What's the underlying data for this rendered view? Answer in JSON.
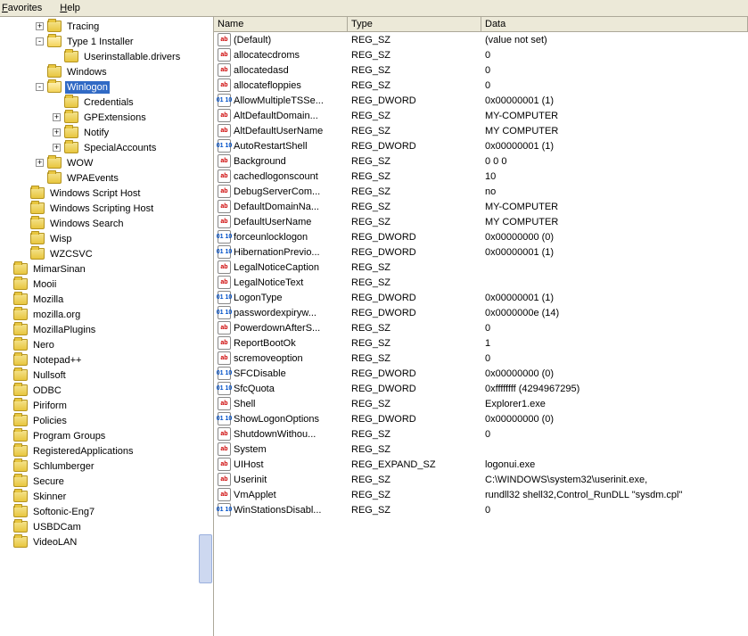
{
  "menu": {
    "favorites": "Favorites",
    "help": "Help"
  },
  "columns": {
    "name": "Name",
    "type": "Type",
    "data": "Data"
  },
  "tree": [
    {
      "indent": 1,
      "expander": "+",
      "label": "Tracing"
    },
    {
      "indent": 1,
      "expander": "-",
      "label": "Type 1 Installer",
      "open": true
    },
    {
      "indent": 2,
      "expander": "",
      "label": "Userinstallable.drivers"
    },
    {
      "indent": 1,
      "expander": "",
      "label": "Windows"
    },
    {
      "indent": 1,
      "expander": "-",
      "label": "Winlogon",
      "open": true,
      "selected": true
    },
    {
      "indent": 2,
      "expander": "",
      "label": "Credentials"
    },
    {
      "indent": 2,
      "expander": "+",
      "label": "GPExtensions"
    },
    {
      "indent": 2,
      "expander": "+",
      "label": "Notify"
    },
    {
      "indent": 2,
      "expander": "+",
      "label": "SpecialAccounts"
    },
    {
      "indent": 1,
      "expander": "+",
      "label": "WOW"
    },
    {
      "indent": 1,
      "expander": "",
      "label": "WPAEvents"
    },
    {
      "indent": 0,
      "expander": "",
      "label": "Windows Script Host"
    },
    {
      "indent": 0,
      "expander": "",
      "label": "Windows Scripting Host"
    },
    {
      "indent": 0,
      "expander": "",
      "label": "Windows Search"
    },
    {
      "indent": 0,
      "expander": "",
      "label": "Wisp"
    },
    {
      "indent": 0,
      "expander": "",
      "label": "WZCSVC"
    },
    {
      "indent": -1,
      "expander": "",
      "label": "MimarSinan"
    },
    {
      "indent": -1,
      "expander": "",
      "label": "Mooii"
    },
    {
      "indent": -1,
      "expander": "",
      "label": "Mozilla"
    },
    {
      "indent": -1,
      "expander": "",
      "label": "mozilla.org"
    },
    {
      "indent": -1,
      "expander": "",
      "label": "MozillaPlugins"
    },
    {
      "indent": -1,
      "expander": "",
      "label": "Nero"
    },
    {
      "indent": -1,
      "expander": "",
      "label": "Notepad++"
    },
    {
      "indent": -1,
      "expander": "",
      "label": "Nullsoft"
    },
    {
      "indent": -1,
      "expander": "",
      "label": "ODBC"
    },
    {
      "indent": -1,
      "expander": "",
      "label": "Piriform"
    },
    {
      "indent": -1,
      "expander": "",
      "label": "Policies"
    },
    {
      "indent": -1,
      "expander": "",
      "label": "Program Groups"
    },
    {
      "indent": -1,
      "expander": "",
      "label": "RegisteredApplications"
    },
    {
      "indent": -1,
      "expander": "",
      "label": "Schlumberger"
    },
    {
      "indent": -1,
      "expander": "",
      "label": "Secure"
    },
    {
      "indent": -1,
      "expander": "",
      "label": "Skinner"
    },
    {
      "indent": -1,
      "expander": "",
      "label": "Softonic-Eng7"
    },
    {
      "indent": -1,
      "expander": "",
      "label": "USBDCam"
    },
    {
      "indent": -1,
      "expander": "",
      "label": "VideoLAN"
    }
  ],
  "values": [
    {
      "icon": "sz",
      "name": "(Default)",
      "type": "REG_SZ",
      "data": "(value not set)"
    },
    {
      "icon": "sz",
      "name": "allocatecdroms",
      "type": "REG_SZ",
      "data": "0"
    },
    {
      "icon": "sz",
      "name": "allocatedasd",
      "type": "REG_SZ",
      "data": "0"
    },
    {
      "icon": "sz",
      "name": "allocatefloppies",
      "type": "REG_SZ",
      "data": "0"
    },
    {
      "icon": "dw",
      "name": "AllowMultipleTSSe...",
      "type": "REG_DWORD",
      "data": "0x00000001 (1)"
    },
    {
      "icon": "sz",
      "name": "AltDefaultDomain...",
      "type": "REG_SZ",
      "data": "MY-COMPUTER"
    },
    {
      "icon": "sz",
      "name": "AltDefaultUserName",
      "type": "REG_SZ",
      "data": "MY COMPUTER"
    },
    {
      "icon": "dw",
      "name": "AutoRestartShell",
      "type": "REG_DWORD",
      "data": "0x00000001 (1)"
    },
    {
      "icon": "sz",
      "name": "Background",
      "type": "REG_SZ",
      "data": "0 0 0"
    },
    {
      "icon": "sz",
      "name": "cachedlogonscount",
      "type": "REG_SZ",
      "data": "10"
    },
    {
      "icon": "sz",
      "name": "DebugServerCom...",
      "type": "REG_SZ",
      "data": "no"
    },
    {
      "icon": "sz",
      "name": "DefaultDomainNa...",
      "type": "REG_SZ",
      "data": "MY-COMPUTER"
    },
    {
      "icon": "sz",
      "name": "DefaultUserName",
      "type": "REG_SZ",
      "data": "MY COMPUTER"
    },
    {
      "icon": "dw",
      "name": "forceunlocklogon",
      "type": "REG_DWORD",
      "data": "0x00000000 (0)"
    },
    {
      "icon": "dw",
      "name": "HibernationPrevio...",
      "type": "REG_DWORD",
      "data": "0x00000001 (1)"
    },
    {
      "icon": "sz",
      "name": "LegalNoticeCaption",
      "type": "REG_SZ",
      "data": ""
    },
    {
      "icon": "sz",
      "name": "LegalNoticeText",
      "type": "REG_SZ",
      "data": ""
    },
    {
      "icon": "dw",
      "name": "LogonType",
      "type": "REG_DWORD",
      "data": "0x00000001 (1)"
    },
    {
      "icon": "dw",
      "name": "passwordexpiryw...",
      "type": "REG_DWORD",
      "data": "0x0000000e (14)"
    },
    {
      "icon": "sz",
      "name": "PowerdownAfterS...",
      "type": "REG_SZ",
      "data": "0"
    },
    {
      "icon": "sz",
      "name": "ReportBootOk",
      "type": "REG_SZ",
      "data": "1"
    },
    {
      "icon": "sz",
      "name": "scremoveoption",
      "type": "REG_SZ",
      "data": "0"
    },
    {
      "icon": "dw",
      "name": "SFCDisable",
      "type": "REG_DWORD",
      "data": "0x00000000 (0)"
    },
    {
      "icon": "dw",
      "name": "SfcQuota",
      "type": "REG_DWORD",
      "data": "0xffffffff (4294967295)"
    },
    {
      "icon": "sz",
      "name": "Shell",
      "type": "REG_SZ",
      "data": "Explorer1.exe"
    },
    {
      "icon": "dw",
      "name": "ShowLogonOptions",
      "type": "REG_DWORD",
      "data": "0x00000000 (0)"
    },
    {
      "icon": "sz",
      "name": "ShutdownWithou...",
      "type": "REG_SZ",
      "data": "0"
    },
    {
      "icon": "sz",
      "name": "System",
      "type": "REG_SZ",
      "data": ""
    },
    {
      "icon": "sz",
      "name": "UIHost",
      "type": "REG_EXPAND_SZ",
      "data": "logonui.exe"
    },
    {
      "icon": "sz",
      "name": "Userinit",
      "type": "REG_SZ",
      "data": "C:\\WINDOWS\\system32\\userinit.exe,"
    },
    {
      "icon": "sz",
      "name": "VmApplet",
      "type": "REG_SZ",
      "data": "rundll32 shell32,Control_RunDLL \"sysdm.cpl\""
    },
    {
      "icon": "dw",
      "name": "WinStationsDisabl...",
      "type": "REG_SZ",
      "data": "0"
    }
  ],
  "icon_text": {
    "sz": "ab",
    "dw": "011\n110"
  }
}
